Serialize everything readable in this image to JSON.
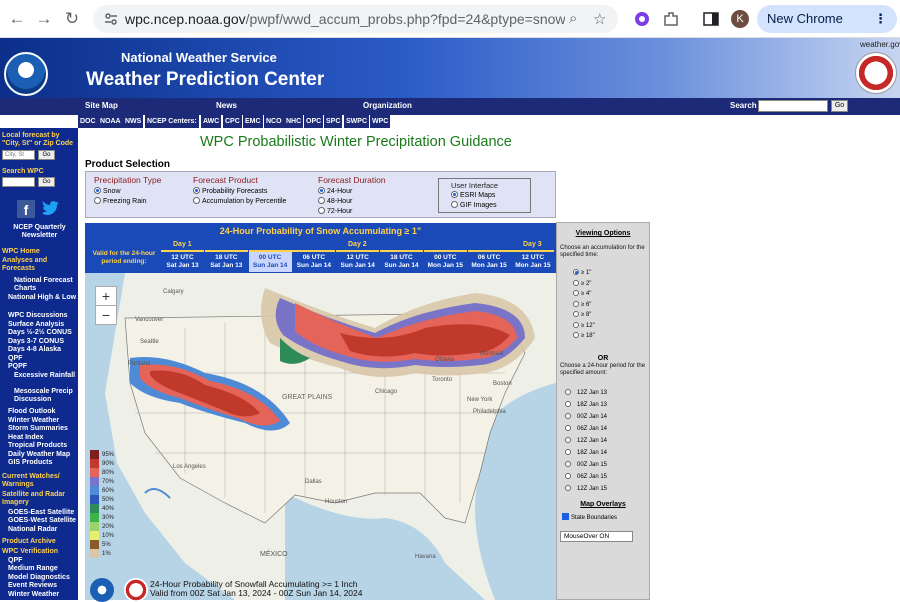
{
  "browser": {
    "url_host": "wpc.ncep.noaa.gov",
    "url_path": "/pwpf/wwd_accum_probs.php?fpd=24&ptype=snow&amt=1&da...",
    "avatar_letter": "K",
    "update_label": "New Chrome available"
  },
  "header": {
    "agency": "National Weather Service",
    "center": "Weather Prediction Center",
    "weather_gov": "weather.gov"
  },
  "topnav": {
    "site_map": "Site Map",
    "news": "News",
    "organization": "Organization",
    "search": "Search",
    "go": "Go"
  },
  "subnav": [
    "DOC",
    "NOAA",
    "NWS",
    "NCEP Centers:",
    "AWC",
    "CPC",
    "EMC",
    "NCO",
    "NHC",
    "OPC",
    "SPC",
    "SWPC",
    "WPC"
  ],
  "sidebar": {
    "local_forecast": "Local forecast by \"City, St\" or Zip Code",
    "city_placeholder": "City, St",
    "go": "Go",
    "search_wpc": "Search WPC",
    "newsletter": "NCEP Quarterly Newsletter",
    "links": [
      {
        "label": "WPC Home",
        "kind": "head"
      },
      {
        "label": "Analyses and Forecasts",
        "kind": "head"
      },
      {
        "label": "National Forecast Charts",
        "kind": "item"
      },
      {
        "label": "National High & Low",
        "kind": "item"
      },
      {
        "label": "WPC Discussions",
        "kind": "item"
      },
      {
        "label": "Surface Analysis",
        "kind": "item"
      },
      {
        "label": "Days ½-2½ CONUS",
        "kind": "item"
      },
      {
        "label": "Days 3-7 CONUS",
        "kind": "item"
      },
      {
        "label": "Days 4-8 Alaska",
        "kind": "item"
      },
      {
        "label": "QPF",
        "kind": "item"
      },
      {
        "label": "PQPF",
        "kind": "item"
      },
      {
        "label": "Excessive Rainfall",
        "kind": "item"
      },
      {
        "label": "Mesoscale Precip Discussion",
        "kind": "item"
      },
      {
        "label": "Flood Outlook",
        "kind": "item"
      },
      {
        "label": "Winter Weather",
        "kind": "item"
      },
      {
        "label": "Storm Summaries",
        "kind": "item"
      },
      {
        "label": "Heat Index",
        "kind": "item"
      },
      {
        "label": "Tropical Products",
        "kind": "item"
      },
      {
        "label": "Daily Weather Map",
        "kind": "item"
      },
      {
        "label": "GIS Products",
        "kind": "item"
      },
      {
        "label": "Current Watches/ Warnings",
        "kind": "head"
      },
      {
        "label": "Satellite and Radar Imagery",
        "kind": "head"
      },
      {
        "label": "GOES-East Satellite",
        "kind": "item"
      },
      {
        "label": "GOES-West Satellite",
        "kind": "item"
      },
      {
        "label": "National Radar",
        "kind": "item"
      },
      {
        "label": "Product Archive",
        "kind": "head"
      },
      {
        "label": "WPC Verification",
        "kind": "head"
      },
      {
        "label": "QPF",
        "kind": "item"
      },
      {
        "label": "Medium Range",
        "kind": "item"
      },
      {
        "label": "Model Diagnostics",
        "kind": "item"
      },
      {
        "label": "Event Reviews",
        "kind": "item"
      },
      {
        "label": "Winter Weather",
        "kind": "item"
      }
    ]
  },
  "page_title": "WPC Probabilistic Winter Precipitation Guidance",
  "product_selection": {
    "heading": "Product Selection",
    "precip_type": {
      "heading": "Precipitation Type",
      "options": [
        "Snow",
        "Freezing Rain"
      ],
      "selected": 0
    },
    "forecast_product": {
      "heading": "Forecast Product",
      "options": [
        "Probability Forecasts",
        "Accumulation by Percentile"
      ],
      "selected": 0
    },
    "forecast_duration": {
      "heading": "Forecast Duration",
      "options": [
        "24-Hour",
        "48-Hour",
        "72-Hour"
      ],
      "selected": 0
    },
    "user_interface": {
      "heading": "User Interface",
      "options": [
        "ESRI Maps",
        "GIF Images"
      ],
      "selected": 0
    }
  },
  "map_panel": {
    "title": "24-Hour Probability of Snow Accumulating ≥ 1\"",
    "valid_label": "Valid for the 24-hour period ending:",
    "days": [
      "Day 1",
      "Day 2",
      "Day 3"
    ],
    "times": [
      {
        "utc": "12 UTC",
        "date": "Sat Jan 13"
      },
      {
        "utc": "18 UTC",
        "date": "Sat Jan 13"
      },
      {
        "utc": "00 UTC",
        "date": "Sun Jan 14"
      },
      {
        "utc": "06 UTC",
        "date": "Sun Jan 14"
      },
      {
        "utc": "12 UTC",
        "date": "Sun Jan 14"
      },
      {
        "utc": "18 UTC",
        "date": "Sun Jan 14"
      },
      {
        "utc": "00 UTC",
        "date": "Mon Jan 15"
      },
      {
        "utc": "06 UTC",
        "date": "Mon Jan 15"
      },
      {
        "utc": "12 UTC",
        "date": "Mon Jan 15"
      }
    ],
    "selected_time": 2,
    "zoom_in": "+",
    "zoom_out": "−",
    "map_labels": [
      "Calgary",
      "Vancouver",
      "Seattle",
      "Portland",
      "Los Angeles",
      "GREAT PLAINS",
      "Chicago",
      "Ottawa",
      "Montreal",
      "Toronto",
      "Boston",
      "New York",
      "Philadelphia",
      "Houston",
      "Dallas",
      "MÉXICO",
      "Havana"
    ],
    "legend": [
      {
        "label": "95%",
        "color": "#7f1e1e"
      },
      {
        "label": "90%",
        "color": "#c0392b"
      },
      {
        "label": "80%",
        "color": "#e4645a"
      },
      {
        "label": "70%",
        "color": "#7a74c9"
      },
      {
        "label": "60%",
        "color": "#4f8ad6"
      },
      {
        "label": "50%",
        "color": "#2c56b8"
      },
      {
        "label": "40%",
        "color": "#2e8b57"
      },
      {
        "label": "30%",
        "color": "#3db44a"
      },
      {
        "label": "20%",
        "color": "#9bd36a"
      },
      {
        "label": "10%",
        "color": "#e7ef6e"
      },
      {
        "label": "5%",
        "color": "#8a5a2b"
      },
      {
        "label": "1%",
        "color": "#d8c7a8"
      }
    ],
    "caption_line1": "24-Hour Probability of Snowfall Accumulating >= 1 Inch",
    "caption_line2": "Valid from 00Z Sat Jan 13, 2024 - 00Z Sun Jan 14, 2024"
  },
  "viewing_options": {
    "heading": "Viewing Options",
    "accum_text": "Choose an accumulation for the specified time:",
    "accum_options": [
      "≥ 1\"",
      "≥ 2\"",
      "≥ 4\"",
      "≥ 6\"",
      "≥ 8\"",
      "≥ 12\"",
      "≥ 18\""
    ],
    "accum_selected": 0,
    "or": "OR",
    "period_text": "Choose a 24-hour period for the specified amount:",
    "period_options": [
      "12Z Jan 13",
      "18Z Jan 13",
      "00Z Jan 14",
      "06Z Jan 14",
      "12Z Jan 14",
      "18Z Jan 14",
      "00Z Jan 15",
      "06Z Jan 15",
      "12Z Jan 15"
    ],
    "overlays_heading": "Map Overlays",
    "state_boundaries": "State Boundaries",
    "mouseover": "MouseOver ON"
  }
}
